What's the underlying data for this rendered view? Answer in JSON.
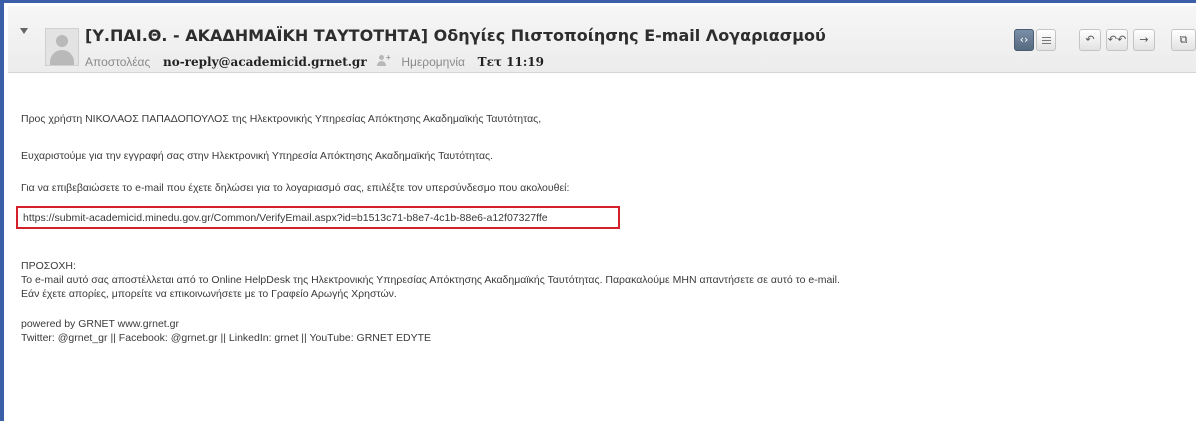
{
  "email": {
    "subject": "[Υ.ΠΑΙ.Θ. - ΑΚΑΔΗΜΑΪΚΗ ΤΑΥΤΟΤΗΤΑ] Οδηγίες Πιστοποίησης E-mail Λογαριασμού",
    "sender_label": "Αποστολέας",
    "sender": "no-reply@academicid.grnet.gr",
    "date_label": "Ημερομηνία",
    "date": "Τετ 11:19"
  },
  "toolbar": {
    "icons": [
      "source-view-icon",
      "list-view-icon",
      "reply-icon",
      "reply-all-icon",
      "forward-icon",
      "more-icon"
    ],
    "glyphs": {
      "source": "‹›",
      "reply": "↶",
      "reply_all": "↶↶",
      "forward": "→",
      "more": "⧉"
    },
    "colors": {
      "active": "#5f728a",
      "frame": "#3a5fa8",
      "highlight": "#d3202a"
    }
  },
  "body": {
    "greeting": "Προς χρήστη ΝΙΚΟΛΑΟΣ ΠΑΠΑΔΟΠΟΥΛΟΣ της Ηλεκτρονικής Υπηρεσίας Απόκτησης Ακαδημαϊκής Ταυτότητας,",
    "thanks": "Ευχαριστούμε για την εγγραφή σας στην Ηλεκτρονική Υπηρεσία Απόκτησης Ακαδημαϊκής Ταυτότητας.",
    "instruction": "Για να επιβεβαιώσετε το e-mail που έχετε δηλώσει για το λογαριασμό σας, επιλέξτε τον υπερσύνδεσμο που ακολουθεί:",
    "link": "https://submit-academicid.minedu.gov.gr/Common/VerifyEmail.aspx?id=b1513c71-b8e7-4c1b-88e6-a12f07327ffe",
    "notice_title": "ΠΡΟΣΟΧΗ:",
    "notice_line1": "Το e-mail αυτό σας αποστέλλεται από το Online HelpDesk της Ηλεκτρονικής Υπηρεσίας Απόκτησης Ακαδημαϊκής Ταυτότητας. Παρακαλούμε ΜΗΝ απαντήσετε σε αυτό το e-mail.",
    "notice_line2": "Εάν έχετε απορίες, μπορείτε να επικοινωνήσετε με το Γραφείο Αρωγής Χρηστών.",
    "powered": "powered by GRNET www.grnet.gr",
    "social": "Twitter: @grnet_gr || Facebook: @grnet.gr || LinkedIn: grnet || YouTube: GRNET EDYTE"
  }
}
